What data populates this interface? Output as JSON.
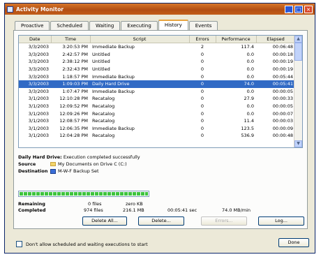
{
  "window": {
    "title": "Activity Monitor"
  },
  "tabs": [
    "Proactive",
    "Scheduled",
    "Waiting",
    "Executing",
    "History",
    "Events"
  ],
  "active_tab": "History",
  "columns": [
    "Date",
    "Time",
    "Script",
    "Errors",
    "Performance",
    "Elapsed"
  ],
  "rows": [
    {
      "date": "3/3/2003",
      "time": "3:20:53 PM",
      "script": "Immediate Backup",
      "errors": "2",
      "performance": "117.4",
      "elapsed": "00:06:48"
    },
    {
      "date": "3/3/2003",
      "time": "2:42:57 PM",
      "script": "Untitled",
      "errors": "0",
      "performance": "0.0",
      "elapsed": "00:00:18"
    },
    {
      "date": "3/3/2003",
      "time": "2:38:12 PM",
      "script": "Untitled",
      "errors": "0",
      "performance": "0.0",
      "elapsed": "00:00:19"
    },
    {
      "date": "3/3/2003",
      "time": "2:32:43 PM",
      "script": "Untitled",
      "errors": "0",
      "performance": "0.0",
      "elapsed": "00:00:19"
    },
    {
      "date": "3/3/2003",
      "time": "1:18:57 PM",
      "script": "Immediate Backup",
      "errors": "0",
      "performance": "0.0",
      "elapsed": "00:05:44"
    },
    {
      "date": "3/3/2003",
      "time": "1:09:03 PM",
      "script": "Daily Hard Drive",
      "errors": "0",
      "performance": "74.0",
      "elapsed": "00:05:41",
      "selected": true
    },
    {
      "date": "3/3/2003",
      "time": "1:07:47 PM",
      "script": "Immediate Backup",
      "errors": "0",
      "performance": "0.0",
      "elapsed": "00:00:05"
    },
    {
      "date": "3/1/2003",
      "time": "12:10:28 PM",
      "script": "Recatalog",
      "errors": "0",
      "performance": "27.9",
      "elapsed": "00:00:33"
    },
    {
      "date": "3/1/2003",
      "time": "12:09:52 PM",
      "script": "Recatalog",
      "errors": "0",
      "performance": "0.0",
      "elapsed": "00:00:05"
    },
    {
      "date": "3/1/2003",
      "time": "12:09:26 PM",
      "script": "Recatalog",
      "errors": "0",
      "performance": "0.0",
      "elapsed": "00:00:07"
    },
    {
      "date": "3/1/2003",
      "time": "12:08:57 PM",
      "script": "Recatalog",
      "errors": "0",
      "performance": "11.4",
      "elapsed": "00:00:03"
    },
    {
      "date": "3/1/2003",
      "time": "12:06:35 PM",
      "script": "Immediate Backup",
      "errors": "0",
      "performance": "123.5",
      "elapsed": "00:00:09"
    },
    {
      "date": "3/1/2003",
      "time": "12:04:28 PM",
      "script": "Recatalog",
      "errors": "0",
      "performance": "536.9",
      "elapsed": "00:00:48"
    }
  ],
  "details": {
    "summary_label": "Daily Hard Drive:",
    "summary_text": "Execution completed successfully",
    "source_label": "Source",
    "source_value": "My Documents on Drive C (C:)",
    "destination_label": "Destination",
    "destination_value": "M-W-F Backup Set"
  },
  "progress": {
    "fraction": 1.0
  },
  "stats": {
    "remaining_label": "Remaining",
    "remaining_files": "0 files",
    "remaining_size": "zero KB",
    "completed_label": "Completed",
    "completed_files": "974 files",
    "completed_size": "216.1 MB",
    "elapsed": "00:05:41 sec",
    "rate": "74.0 MB/min"
  },
  "buttons": {
    "delete_all": "Delete All...",
    "delete": "Delete...",
    "errors": "Errors...",
    "log": "Log...",
    "done": "Done"
  },
  "footer": {
    "checkbox_label": "Don't allow scheduled and waiting executions to start"
  },
  "colors": {
    "titlebar": "#c25d19",
    "selection": "#316ac5",
    "progress": "#3ec43e"
  }
}
